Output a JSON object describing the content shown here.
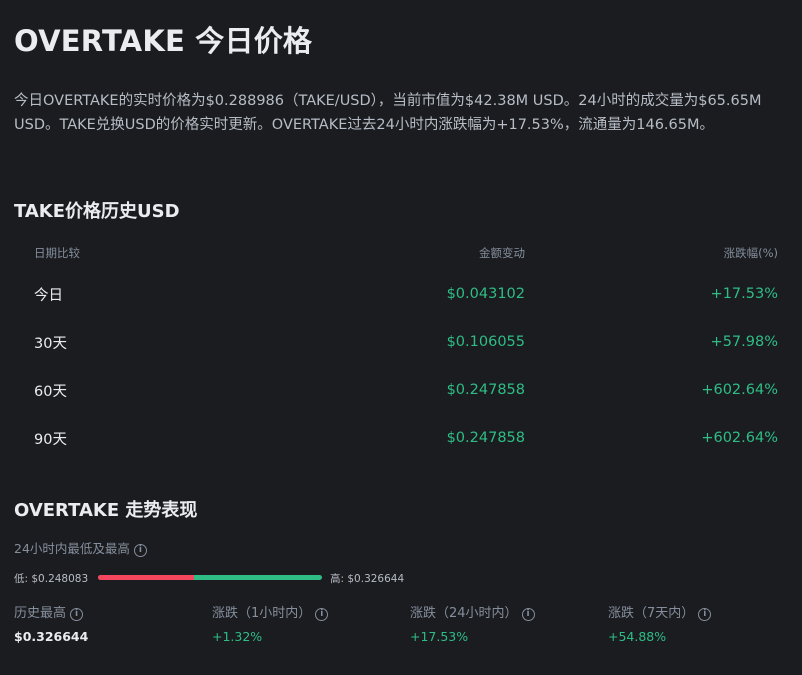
{
  "page_title": "OVERTAKE 今日价格",
  "description": "今日OVERTAKE的实时价格为$0.288986（TAKE/USD），当前市值为$42.38M USD。24小时的成交量为$65.65M USD。TAKE兑换USD的价格实时更新。OVERTAKE过去24小时内涨跌幅为+17.53%，流通量为146.65M。",
  "history": {
    "title": "TAKE价格历史USD",
    "headers": {
      "period": "日期比较",
      "change": "金额变动",
      "percent": "涨跌幅(%)"
    },
    "rows": [
      {
        "period": "今日",
        "change": "$0.043102",
        "percent": "+17.53%"
      },
      {
        "period": "30天",
        "change": "$0.106055",
        "percent": "+57.98%"
      },
      {
        "period": "60天",
        "change": "$0.247858",
        "percent": "+602.64%"
      },
      {
        "period": "90天",
        "change": "$0.247858",
        "percent": "+602.64%"
      }
    ]
  },
  "performance": {
    "title": "OVERTAKE 走势表现",
    "range_label": "24小时内最低及最高",
    "low": "低: $0.248083",
    "high": "高: $0.326644",
    "low_share": 0.43,
    "stats": [
      {
        "label": "历史最高",
        "value": "$0.326644"
      },
      {
        "label": "涨跌（1小时内）",
        "value": "+1.32%"
      },
      {
        "label": "涨跌（24小时内）",
        "value": "+17.53%"
      },
      {
        "label": "涨跌（7天内）",
        "value": "+54.88%"
      }
    ]
  },
  "colors": {
    "up": "#2ebd85",
    "down": "#f6465d",
    "background": "#1b1c20"
  },
  "icons": {
    "info": "info-circle-icon"
  }
}
